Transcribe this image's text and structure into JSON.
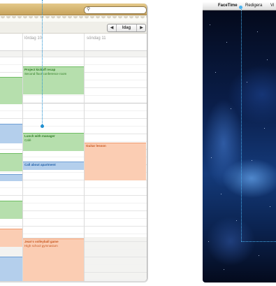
{
  "calendar": {
    "search": {
      "icon": "magnifier-icon",
      "placeholder": ""
    },
    "toolbar": {
      "prev_label": "◀",
      "today_label": "Idag",
      "next_label": "▶"
    },
    "day_headers": [
      {
        "label": ""
      },
      {
        "label": "lördag 10"
      },
      {
        "label": "söndag 11"
      }
    ],
    "events": [
      {
        "column": "left",
        "title": "",
        "detail": "",
        "color": "green"
      },
      {
        "column": "left",
        "title": "",
        "detail": "",
        "color": "blue"
      },
      {
        "column": "left",
        "title": "",
        "detail": "",
        "color": "green"
      },
      {
        "column": "left",
        "title": "",
        "detail": "",
        "color": "blue"
      },
      {
        "column": "left",
        "title": "",
        "detail": "",
        "color": "green"
      },
      {
        "column": "left",
        "title": "",
        "detail": "",
        "color": "orange"
      },
      {
        "column": "left",
        "title": "",
        "detail": "",
        "color": "blue"
      },
      {
        "column": "lördag 10",
        "title": "Project kickoff recap",
        "detail": "Second floor conference room",
        "color": "green"
      },
      {
        "column": "lördag 10",
        "title": "Lunch with manager",
        "detail": "Café",
        "color": "green"
      },
      {
        "column": "lördag 10",
        "title": "Call about apartment",
        "detail": "",
        "color": "blue"
      },
      {
        "column": "lördag 10",
        "title": "Jean's volleyball game",
        "detail": "High school gymnasium",
        "color": "orange"
      },
      {
        "column": "söndag 11",
        "title": "Guitar lesson",
        "detail": "",
        "color": "orange"
      }
    ],
    "colors": {
      "green": "#b6dfad",
      "blue": "#b4cfec",
      "orange": "#fbcdb3",
      "accent": "#1f8fd0"
    }
  },
  "desktop": {
    "menubar": {
      "apple_icon": "",
      "app_name": "FaceTime",
      "edit_menu": "Redigera",
      "view_menu": "Vi"
    },
    "wallpaper": "space-galaxy"
  }
}
